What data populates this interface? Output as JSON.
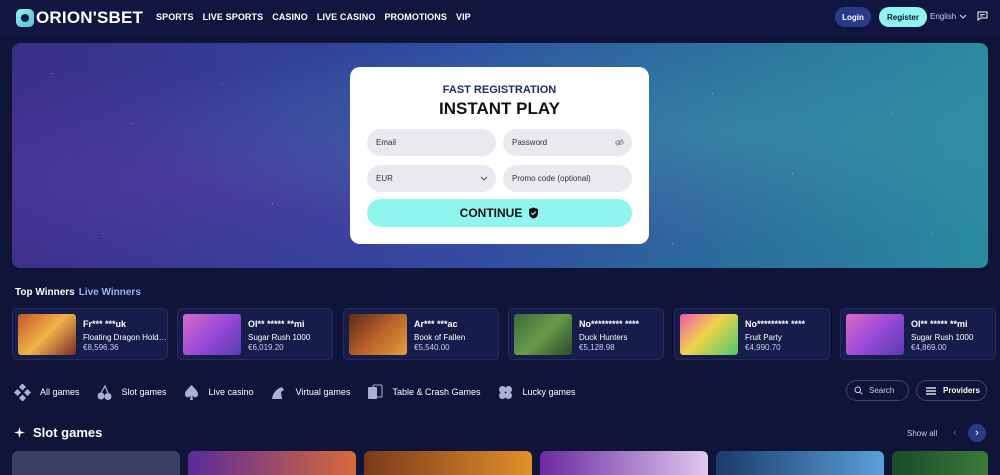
{
  "brand": {
    "name": "ORION'SBET"
  },
  "nav": [
    "SPORTS",
    "LIVE SPORTS",
    "CASINO",
    "LIVE CASINO",
    "PROMOTIONS",
    "VIP"
  ],
  "header": {
    "login_label": "Login",
    "register_label": "Register",
    "language": "English"
  },
  "registration": {
    "subtitle": "FAST REGISTRATION",
    "title": "INSTANT PLAY",
    "email_placeholder": "Email",
    "password_placeholder": "Password",
    "currency_value": "EUR",
    "promo_placeholder": "Promo code (optional)",
    "continue_label": "CONTINUE"
  },
  "winners": {
    "title": "Top Winners",
    "live_title": "Live Winners",
    "items": [
      {
        "name": "Fr*** ***uk",
        "game": "Floating Dragon Hold ...",
        "amount": "€8,596.36"
      },
      {
        "name": "Ol** ***** **mi",
        "game": "Sugar Rush 1000",
        "amount": "€6,019.20"
      },
      {
        "name": "Ar*** ***ac",
        "game": "Book of Fallen",
        "amount": "€5,540.00"
      },
      {
        "name": "No********* ****",
        "game": "Duck Hunters",
        "amount": "€5,128.98"
      },
      {
        "name": "No********* ****",
        "game": "Fruit Party",
        "amount": "€4,990.70"
      },
      {
        "name": "Ol** ***** **mi",
        "game": "Sugar Rush 1000",
        "amount": "€4,869.00"
      }
    ]
  },
  "categories": [
    "All games",
    "Slot games",
    "Live casino",
    "Virtual games",
    "Table & Crash Games",
    "Lucky games"
  ],
  "search_label": "Search",
  "providers_label": "Providers",
  "slot_section": {
    "title": "Slot games",
    "show_all": "Show all"
  },
  "colors": {
    "accent": "#8ff5ee",
    "background": "#0f1438",
    "header": "#10163f",
    "login": "#2a3a8a"
  }
}
